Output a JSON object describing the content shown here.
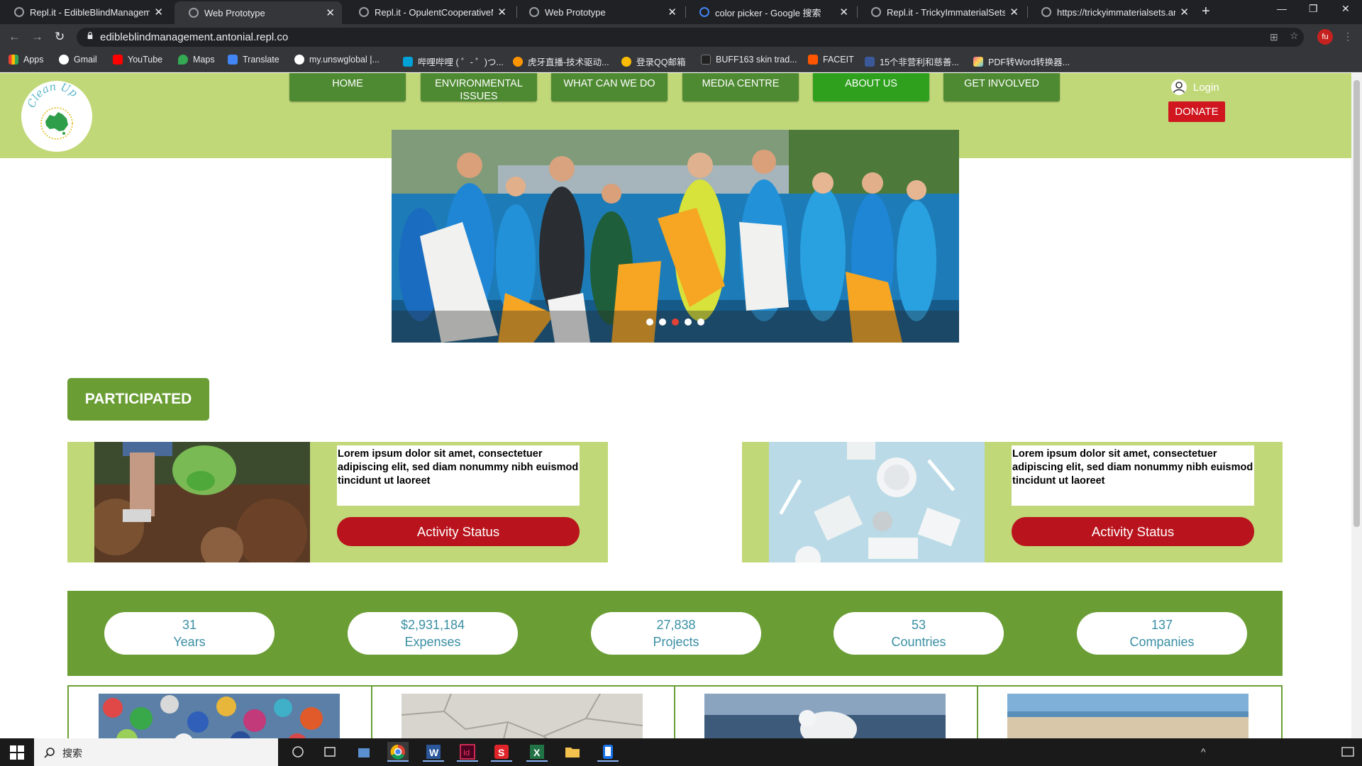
{
  "browser": {
    "tabs": [
      {
        "title": "Repl.it - EdibleBlindManagem",
        "active": false
      },
      {
        "title": "Web Prototype",
        "active": true
      },
      {
        "title": "Repl.it - OpulentCooperativeM",
        "active": false
      },
      {
        "title": "Web Prototype",
        "active": false
      },
      {
        "title": "color picker - Google 搜索",
        "active": false
      },
      {
        "title": "Repl.it - TrickyImmaterialSets",
        "active": false
      },
      {
        "title": "https://trickyimmaterialsets.an",
        "active": false
      }
    ],
    "url": "edibleblindmanagement.antonial.repl.co",
    "profile_initials": "fu",
    "bookmarks": [
      {
        "label": "Apps",
        "color": "#e8eaed"
      },
      {
        "label": "Gmail",
        "color": "#ffffff"
      },
      {
        "label": "YouTube",
        "color": "#ff0000"
      },
      {
        "label": "Maps",
        "color": "#34a853"
      },
      {
        "label": "Translate",
        "color": "#4285f4"
      },
      {
        "label": "my.unswglobal |...",
        "color": "#ffffff"
      },
      {
        "label": "哔哩哔哩 ( ゜- ゜)つ...",
        "color": "#00a1d6"
      },
      {
        "label": "虎牙直播-技术驱动...",
        "color": "#ff9600"
      },
      {
        "label": "登录QQ邮箱",
        "color": "#fbbc05"
      },
      {
        "label": "BUFF163 skin trad...",
        "color": "#222222"
      },
      {
        "label": "FACEIT",
        "color": "#ff5500"
      },
      {
        "label": "15个非营利和慈善...",
        "color": "#3b5998"
      },
      {
        "label": "PDF转Word转换器...",
        "color": "#f06292"
      }
    ]
  },
  "site": {
    "nav": [
      {
        "label": "HOME",
        "active": false
      },
      {
        "label": "ENVIRONMENTAL ISSUES",
        "active": false
      },
      {
        "label": "WHAT CAN WE DO",
        "active": false
      },
      {
        "label": "MEDIA CENTRE",
        "active": false
      },
      {
        "label": "ABOUT US",
        "active": true
      },
      {
        "label": "GET INVOLVED",
        "active": false
      }
    ],
    "logo_text": "Clean Up",
    "login_label": "Login",
    "donate_label": "DONATE",
    "carousel": {
      "slide_count": 5,
      "active_index": 2
    },
    "section_title": "PARTICIPATED",
    "cards": [
      {
        "text": "Lorem ipsum dolor sit amet, consectetuer adipiscing elit, sed diam nonummy nibh euismod tincidunt ut laoreet",
        "button": "Activity Status"
      },
      {
        "text": "Lorem ipsum dolor sit amet, consectetuer adipiscing elit, sed diam nonummy nibh euismod tincidunt ut laoreet",
        "button": "Activity Status"
      }
    ],
    "stats": [
      {
        "value": "31",
        "label": "Years"
      },
      {
        "value": "$2,931,184",
        "label": "Expenses"
      },
      {
        "value": "27,838",
        "label": "Projects"
      },
      {
        "value": "53",
        "label": "Countries"
      },
      {
        "value": "137",
        "label": "Companies"
      }
    ],
    "colors": {
      "header_green": "#c1d879",
      "nav_green": "#4e8a32",
      "nav_active": "#2ea01e",
      "dark_green": "#6a9e35",
      "red": "#b9141d",
      "stat_text": "#3a8fa3"
    }
  },
  "taskbar": {
    "search_placeholder": "搜索"
  }
}
